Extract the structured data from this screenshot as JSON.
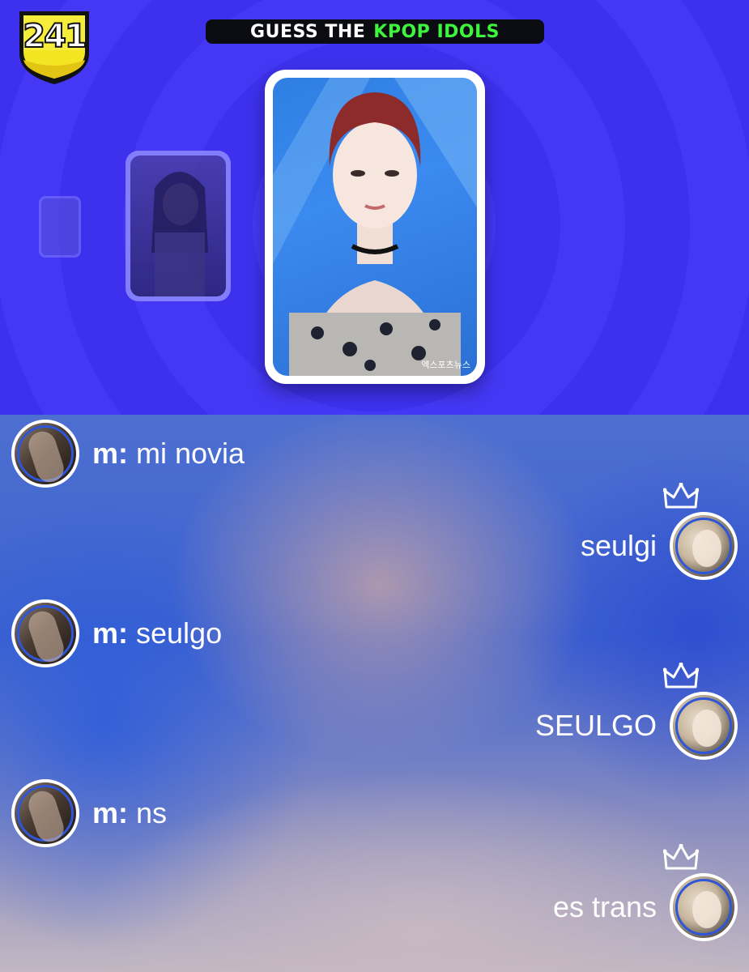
{
  "game": {
    "level_badge": "241",
    "title_part1": "GUESS THE",
    "title_part2": "KPOP IDOLS",
    "watermark": "엑스포츠뉴스"
  },
  "chat": {
    "messages": [
      {
        "side": "left",
        "sender": "m:",
        "text": "mi novia"
      },
      {
        "side": "right",
        "text": "seulgi"
      },
      {
        "side": "left",
        "sender": "m:",
        "text": "seulgo"
      },
      {
        "side": "right",
        "text": "SEULGO"
      },
      {
        "side": "left",
        "sender": "m:",
        "text": "ns"
      },
      {
        "side": "right",
        "text": "es trans"
      }
    ]
  },
  "colors": {
    "game_bg": "#4438f5",
    "title_green": "#3df53d",
    "badge_yellow": "#f3e521",
    "avatar_ring": "#2d56d8"
  }
}
